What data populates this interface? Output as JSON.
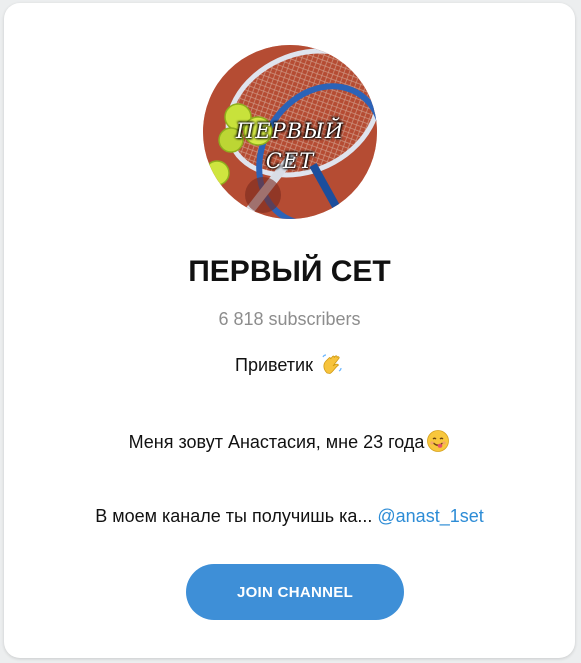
{
  "channel": {
    "avatar_text_line1": "ПЕРВЫЙ",
    "avatar_text_line2": "СЕТ",
    "title": "ПЕРВЫЙ СЕТ",
    "subscribers": "6 818 subscribers"
  },
  "description": {
    "line1": "Приветик",
    "line1_emoji": "waving-hand-icon",
    "line2": "Меня зовут Анастасия, мне 23 года",
    "line2_emoji": "smiling-face-tongue-icon",
    "line3": "В моем канале ты получишь ка...",
    "line3_link": "@anast_1set"
  },
  "actions": {
    "join_label": "JOIN CHANNEL"
  },
  "colors": {
    "accent": "#3e8fd7",
    "link": "#2d8cd6",
    "muted": "#8d8d8d"
  }
}
